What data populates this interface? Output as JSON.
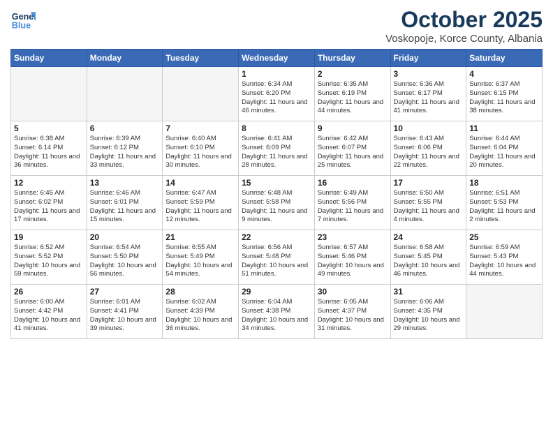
{
  "header": {
    "logo_line1": "General",
    "logo_line2": "Blue",
    "month": "October 2025",
    "location": "Voskopoje, Korce County, Albania"
  },
  "weekdays": [
    "Sunday",
    "Monday",
    "Tuesday",
    "Wednesday",
    "Thursday",
    "Friday",
    "Saturday"
  ],
  "weeks": [
    [
      {
        "day": "",
        "info": ""
      },
      {
        "day": "",
        "info": ""
      },
      {
        "day": "",
        "info": ""
      },
      {
        "day": "1",
        "info": "Sunrise: 6:34 AM\nSunset: 6:20 PM\nDaylight: 11 hours\nand 46 minutes."
      },
      {
        "day": "2",
        "info": "Sunrise: 6:35 AM\nSunset: 6:19 PM\nDaylight: 11 hours\nand 44 minutes."
      },
      {
        "day": "3",
        "info": "Sunrise: 6:36 AM\nSunset: 6:17 PM\nDaylight: 11 hours\nand 41 minutes."
      },
      {
        "day": "4",
        "info": "Sunrise: 6:37 AM\nSunset: 6:15 PM\nDaylight: 11 hours\nand 38 minutes."
      }
    ],
    [
      {
        "day": "5",
        "info": "Sunrise: 6:38 AM\nSunset: 6:14 PM\nDaylight: 11 hours\nand 36 minutes."
      },
      {
        "day": "6",
        "info": "Sunrise: 6:39 AM\nSunset: 6:12 PM\nDaylight: 11 hours\nand 33 minutes."
      },
      {
        "day": "7",
        "info": "Sunrise: 6:40 AM\nSunset: 6:10 PM\nDaylight: 11 hours\nand 30 minutes."
      },
      {
        "day": "8",
        "info": "Sunrise: 6:41 AM\nSunset: 6:09 PM\nDaylight: 11 hours\nand 28 minutes."
      },
      {
        "day": "9",
        "info": "Sunrise: 6:42 AM\nSunset: 6:07 PM\nDaylight: 11 hours\nand 25 minutes."
      },
      {
        "day": "10",
        "info": "Sunrise: 6:43 AM\nSunset: 6:06 PM\nDaylight: 11 hours\nand 22 minutes."
      },
      {
        "day": "11",
        "info": "Sunrise: 6:44 AM\nSunset: 6:04 PM\nDaylight: 11 hours\nand 20 minutes."
      }
    ],
    [
      {
        "day": "12",
        "info": "Sunrise: 6:45 AM\nSunset: 6:02 PM\nDaylight: 11 hours\nand 17 minutes."
      },
      {
        "day": "13",
        "info": "Sunrise: 6:46 AM\nSunset: 6:01 PM\nDaylight: 11 hours\nand 15 minutes."
      },
      {
        "day": "14",
        "info": "Sunrise: 6:47 AM\nSunset: 5:59 PM\nDaylight: 11 hours\nand 12 minutes."
      },
      {
        "day": "15",
        "info": "Sunrise: 6:48 AM\nSunset: 5:58 PM\nDaylight: 11 hours\nand 9 minutes."
      },
      {
        "day": "16",
        "info": "Sunrise: 6:49 AM\nSunset: 5:56 PM\nDaylight: 11 hours\nand 7 minutes."
      },
      {
        "day": "17",
        "info": "Sunrise: 6:50 AM\nSunset: 5:55 PM\nDaylight: 11 hours\nand 4 minutes."
      },
      {
        "day": "18",
        "info": "Sunrise: 6:51 AM\nSunset: 5:53 PM\nDaylight: 11 hours\nand 2 minutes."
      }
    ],
    [
      {
        "day": "19",
        "info": "Sunrise: 6:52 AM\nSunset: 5:52 PM\nDaylight: 10 hours\nand 59 minutes."
      },
      {
        "day": "20",
        "info": "Sunrise: 6:54 AM\nSunset: 5:50 PM\nDaylight: 10 hours\nand 56 minutes."
      },
      {
        "day": "21",
        "info": "Sunrise: 6:55 AM\nSunset: 5:49 PM\nDaylight: 10 hours\nand 54 minutes."
      },
      {
        "day": "22",
        "info": "Sunrise: 6:56 AM\nSunset: 5:48 PM\nDaylight: 10 hours\nand 51 minutes."
      },
      {
        "day": "23",
        "info": "Sunrise: 6:57 AM\nSunset: 5:46 PM\nDaylight: 10 hours\nand 49 minutes."
      },
      {
        "day": "24",
        "info": "Sunrise: 6:58 AM\nSunset: 5:45 PM\nDaylight: 10 hours\nand 46 minutes."
      },
      {
        "day": "25",
        "info": "Sunrise: 6:59 AM\nSunset: 5:43 PM\nDaylight: 10 hours\nand 44 minutes."
      }
    ],
    [
      {
        "day": "26",
        "info": "Sunrise: 6:00 AM\nSunset: 4:42 PM\nDaylight: 10 hours\nand 41 minutes."
      },
      {
        "day": "27",
        "info": "Sunrise: 6:01 AM\nSunset: 4:41 PM\nDaylight: 10 hours\nand 39 minutes."
      },
      {
        "day": "28",
        "info": "Sunrise: 6:02 AM\nSunset: 4:39 PM\nDaylight: 10 hours\nand 36 minutes."
      },
      {
        "day": "29",
        "info": "Sunrise: 6:04 AM\nSunset: 4:38 PM\nDaylight: 10 hours\nand 34 minutes."
      },
      {
        "day": "30",
        "info": "Sunrise: 6:05 AM\nSunset: 4:37 PM\nDaylight: 10 hours\nand 31 minutes."
      },
      {
        "day": "31",
        "info": "Sunrise: 6:06 AM\nSunset: 4:35 PM\nDaylight: 10 hours\nand 29 minutes."
      },
      {
        "day": "",
        "info": ""
      }
    ]
  ]
}
